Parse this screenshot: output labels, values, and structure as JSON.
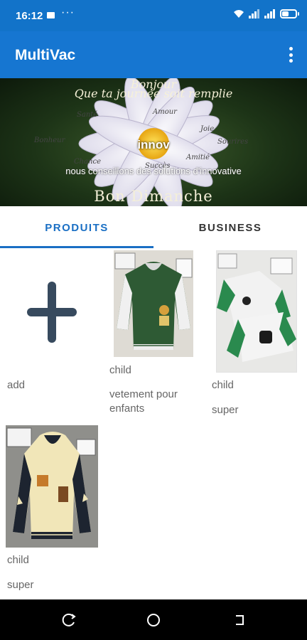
{
  "status_bar": {
    "time": "16:12",
    "more": "···"
  },
  "app_bar": {
    "title": "MultiVac"
  },
  "banner": {
    "greeting": "Bonjour",
    "line2": "Que ta journée soit remplie",
    "brand": "innov",
    "caption": "nous conseillons des solutions d'innovative",
    "footer": "Bon Dimanche",
    "petal_words": [
      "Santé",
      "Amour",
      "Joie",
      "Bonheur",
      "Sourires",
      "Chance",
      "Amitié",
      "Succès"
    ]
  },
  "tabs": [
    {
      "label": "PRODUITS",
      "active": true
    },
    {
      "label": "BUSINESS",
      "active": false
    }
  ],
  "products": [
    {
      "title": "add",
      "desc": ""
    },
    {
      "title": "child",
      "desc": "vetement pour enfants"
    },
    {
      "title": "child",
      "desc": "super"
    },
    {
      "title": "child",
      "desc": "super"
    }
  ],
  "colors": {
    "primary": "#1676d1",
    "status_bar": "#1273c9",
    "tab_active": "#1a6fc4",
    "add_icon": "#374a5e"
  }
}
